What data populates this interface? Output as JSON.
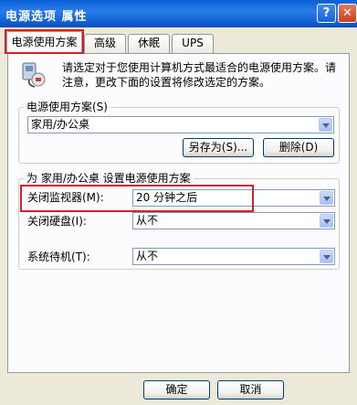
{
  "window": {
    "title": "电源选项 属性",
    "help_label": "?",
    "close_label": "✕"
  },
  "tabs": [
    "电源使用方案",
    "高级",
    "休眠",
    "UPS"
  ],
  "intro_text": "请选定对于您使用计算机方式最适合的电源使用方案。请注意，更改下面的设置将修改选定的方案。",
  "scheme_group": {
    "legend": "电源使用方案(S)",
    "selected": "家用/办公桌",
    "save_as_label": "另存为(S)...",
    "delete_label": "删除(D)"
  },
  "settings_group": {
    "legend": "为 家用/办公桌 设置电源使用方案",
    "rows": [
      {
        "label": "关闭监视器(M):",
        "value": "20 分钟之后"
      },
      {
        "label": "关闭硬盘(I):",
        "value": "从不"
      },
      {
        "label": "系统待机(T):",
        "value": "从不"
      }
    ]
  },
  "footer": {
    "ok_label": "确定",
    "cancel_label": "取消"
  },
  "colors": {
    "highlight": "#d4202b",
    "titlebar": "#0a5fd8"
  }
}
